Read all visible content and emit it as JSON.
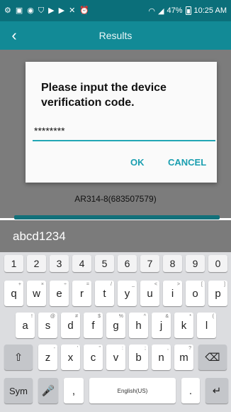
{
  "status_bar": {
    "icons": [
      "settings-icon",
      "image-icon",
      "chat-icon",
      "shield-icon",
      "play-icon",
      "play-icon",
      "no-sim-icon",
      "alarm-icon",
      "wifi-icon",
      "signal-icon"
    ],
    "battery": "47%",
    "time": "10:25 AM"
  },
  "app_bar": {
    "title": "Results",
    "back_icon": "back-arrow-icon"
  },
  "dialog": {
    "title": "Please input the device verification code.",
    "input_value": "********",
    "ok_label": "OK",
    "cancel_label": "CANCEL"
  },
  "device": {
    "id_text": "AR314-8(683507579)"
  },
  "keyboard": {
    "suggestion": "abcd1234",
    "number_row": [
      "1",
      "2",
      "3",
      "4",
      "5",
      "6",
      "7",
      "8",
      "9",
      "0"
    ],
    "row1": [
      {
        "k": "q",
        "s": "+"
      },
      {
        "k": "w",
        "s": "×"
      },
      {
        "k": "e",
        "s": "÷"
      },
      {
        "k": "r",
        "s": "="
      },
      {
        "k": "t",
        "s": "/"
      },
      {
        "k": "y",
        "s": "_"
      },
      {
        "k": "u",
        "s": "<"
      },
      {
        "k": "i",
        "s": ">"
      },
      {
        "k": "o",
        "s": "["
      },
      {
        "k": "p",
        "s": "]"
      }
    ],
    "row2": [
      {
        "k": "a",
        "s": "!"
      },
      {
        "k": "s",
        "s": "@"
      },
      {
        "k": "d",
        "s": "#"
      },
      {
        "k": "f",
        "s": "$"
      },
      {
        "k": "g",
        "s": "%"
      },
      {
        "k": "h",
        "s": "^"
      },
      {
        "k": "j",
        "s": "&"
      },
      {
        "k": "k",
        "s": "*"
      },
      {
        "k": "l",
        "s": "("
      }
    ],
    "row3": [
      {
        "k": "z",
        "s": "-"
      },
      {
        "k": "x",
        "s": "'"
      },
      {
        "k": "c",
        "s": "\""
      },
      {
        "k": "v",
        "s": ":"
      },
      {
        "k": "b",
        "s": ";"
      },
      {
        "k": "n",
        "s": ","
      },
      {
        "k": "m",
        "s": "?"
      }
    ],
    "sym_label": "Sym",
    "comma_label": ",",
    "space_label": "English(US)",
    "period_label": "."
  }
}
